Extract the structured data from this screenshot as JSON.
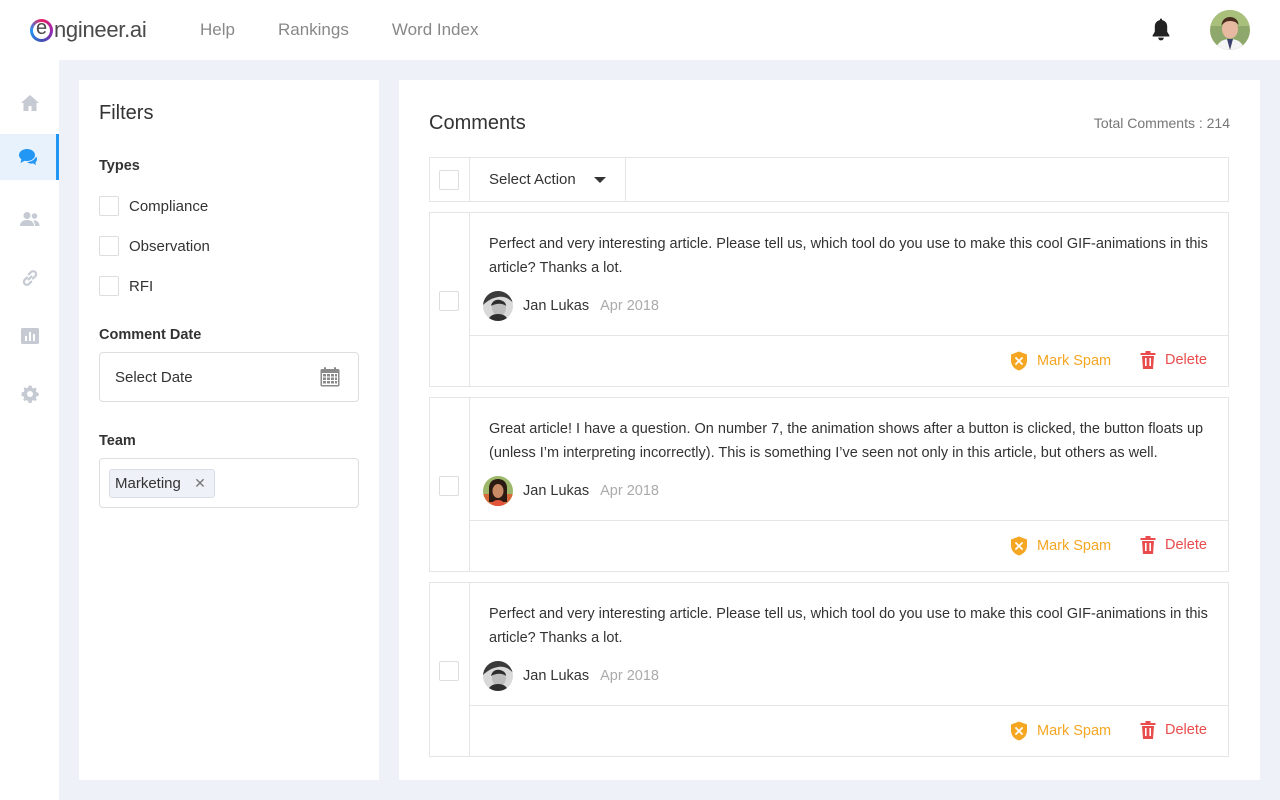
{
  "app": {
    "logo_initial": "e",
    "logo_text": "ngineer.ai"
  },
  "nav": {
    "items": [
      "Help",
      "Rankings",
      "Word Index"
    ]
  },
  "sidebar": {
    "items": [
      {
        "icon": "home-icon",
        "active": false
      },
      {
        "icon": "comments-icon",
        "active": true
      },
      {
        "icon": "users-icon",
        "active": false
      },
      {
        "icon": "link-icon",
        "active": false
      },
      {
        "icon": "chart-icon",
        "active": false
      },
      {
        "icon": "gear-icon",
        "active": false
      }
    ]
  },
  "filters": {
    "title": "Filters",
    "types_label": "Types",
    "types": [
      "Compliance",
      "Observation",
      "RFI"
    ],
    "date_label": "Comment Date",
    "date_placeholder": "Select Date",
    "team_label": "Team",
    "team_tags": [
      "Marketing"
    ]
  },
  "comments": {
    "title": "Comments",
    "total_label": "Total Comments : 214",
    "select_action": "Select Action",
    "mark_spam_label": "Mark Spam",
    "delete_label": "Delete",
    "items": [
      {
        "text": "Perfect and very interesting article. Please tell us, which tool do you use to make this cool GIF-animations in this article? Thanks a lot.",
        "author": "Jan Lukas",
        "date": "Apr 2018"
      },
      {
        "text": "Great article! I have a question. On number 7, the animation shows after a button is clicked, the button floats up (unless I’m interpreting incorrectly). This is something I’ve seen not only in this article, but others as well.",
        "author": "Jan Lukas",
        "date": "Apr 2018"
      },
      {
        "text": "Perfect and very interesting article. Please tell us, which tool do you use to make this cool GIF-animations in this article? Thanks a lot.",
        "author": "Jan Lukas",
        "date": "Apr 2018"
      }
    ]
  },
  "colors": {
    "accent": "#2196f3",
    "spam": "#f5a623",
    "delete": "#e84c4c",
    "background": "#eef2f8"
  }
}
